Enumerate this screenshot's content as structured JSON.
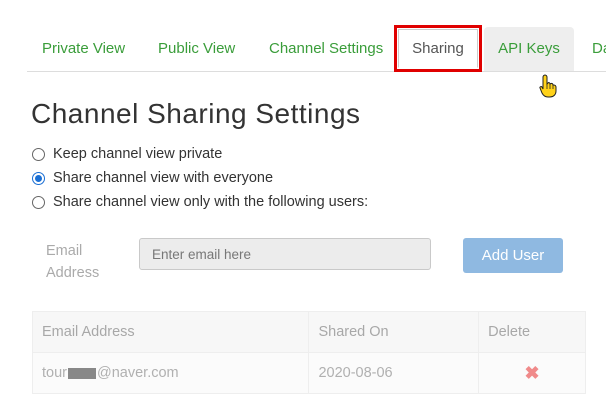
{
  "tabs": {
    "private_view": "Private View",
    "public_view": "Public View",
    "channel_settings": "Channel Settings",
    "sharing": "Sharing",
    "api_keys": "API Keys",
    "data_partial": "Da"
  },
  "page_title": "Channel Sharing Settings",
  "sharing_options": [
    {
      "label": "Keep channel view private",
      "checked": false
    },
    {
      "label": "Share channel view with everyone",
      "checked": true
    },
    {
      "label": "Share channel view only with the following users:",
      "checked": false
    }
  ],
  "email_form": {
    "label_line1": "Email",
    "label_line2": "Address",
    "placeholder": "Enter email here",
    "add_button": "Add User"
  },
  "table": {
    "headers": [
      "Email Address",
      "Shared On",
      "Delete"
    ],
    "rows": [
      {
        "email_prefix": "tour",
        "email_suffix": "@naver.com",
        "shared_on": "2020-08-06",
        "delete_icon": "close-x"
      }
    ]
  },
  "colors": {
    "tab_link": "#3a9d3a",
    "highlight": "#e00000",
    "add_button": "#8fb9e1",
    "radio_checked": "#1a6fd4",
    "delete": "#f08a8a"
  }
}
